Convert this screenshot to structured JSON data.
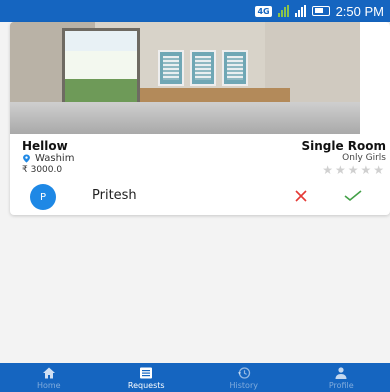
{
  "status_bar": {
    "network": "4G",
    "time": "2:50 PM"
  },
  "listing": {
    "title": "Hellow",
    "location": "Washim",
    "price": "₹ 3000.0",
    "room_type": "Single Room",
    "gender": "Only Girls",
    "rating_stars": 0
  },
  "request": {
    "avatar_letter": "P",
    "name": "Pritesh"
  },
  "nav": {
    "items": [
      {
        "label": "Home",
        "icon": "home-icon"
      },
      {
        "label": "Requests",
        "icon": "list-icon"
      },
      {
        "label": "History",
        "icon": "history-icon"
      },
      {
        "label": "Profile",
        "icon": "person-icon"
      }
    ],
    "active": "Requests"
  },
  "colors": {
    "primary": "#1565c0",
    "avatar": "#1e88e5",
    "reject": "#e53935",
    "accept": "#43a047",
    "pin": "#1e88e5"
  }
}
